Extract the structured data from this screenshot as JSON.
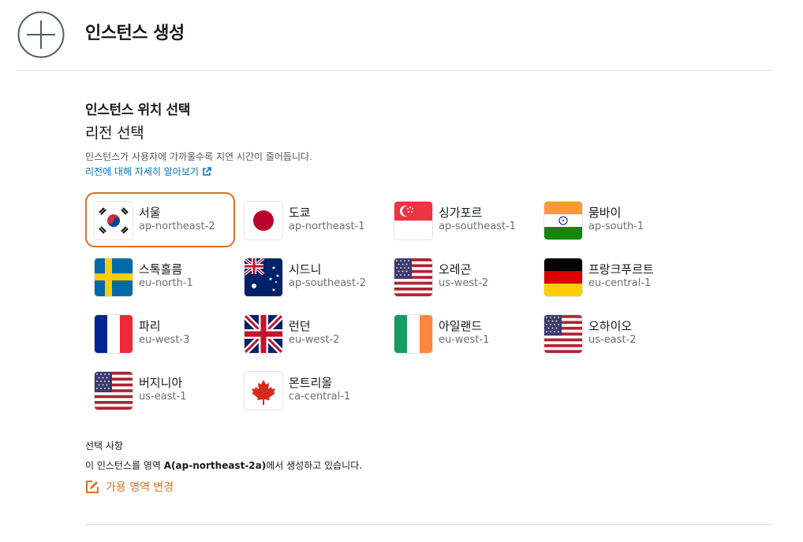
{
  "header": {
    "title": "인스턴스 생성"
  },
  "location": {
    "section_title": "인스턴스 위치 선택",
    "sub_title": "리전 선택",
    "description": "인스턴스가 사용자에 가까울수록 지연 시간이 줄어듭니다.",
    "learn_more": "리전에 대해 자세히 알아보기"
  },
  "regions": [
    {
      "name": "서울",
      "code": "ap-northeast-2",
      "flag": "kr-flag-icon",
      "selected": true
    },
    {
      "name": "도쿄",
      "code": "ap-northeast-1",
      "flag": "jp-flag-icon"
    },
    {
      "name": "싱가포르",
      "code": "ap-southeast-1",
      "flag": "sg-flag-icon"
    },
    {
      "name": "뭄바이",
      "code": "ap-south-1",
      "flag": "in-flag-icon"
    },
    {
      "name": "스톡홀름",
      "code": "eu-north-1",
      "flag": "se-flag-icon"
    },
    {
      "name": "시드니",
      "code": "ap-southeast-2",
      "flag": "au-flag-icon"
    },
    {
      "name": "오레곤",
      "code": "us-west-2",
      "flag": "us-flag-icon"
    },
    {
      "name": "프랑크푸르트",
      "code": "eu-central-1",
      "flag": "de-flag-icon"
    },
    {
      "name": "파리",
      "code": "eu-west-3",
      "flag": "fr-flag-icon"
    },
    {
      "name": "런던",
      "code": "eu-west-2",
      "flag": "uk-flag-icon"
    },
    {
      "name": "아일랜드",
      "code": "eu-west-1",
      "flag": "ie-flag-icon"
    },
    {
      "name": "오하이오",
      "code": "us-east-2",
      "flag": "us-flag-icon"
    },
    {
      "name": "버지니아",
      "code": "us-east-1",
      "flag": "us-flag-icon"
    },
    {
      "name": "몬트리올",
      "code": "ca-central-1",
      "flag": "ca-flag-icon"
    }
  ],
  "selection": {
    "label": "선택 사항",
    "text_prefix": "이 인스턴스를 영역 ",
    "zone": "A(ap-northeast-2a)",
    "text_suffix": "에서 생성하고 있습니다.",
    "change_label": "가용 영역 변경"
  },
  "colors": {
    "accent": "#d9701f",
    "link": "#0073bb",
    "divider": "#d5dbdb"
  }
}
